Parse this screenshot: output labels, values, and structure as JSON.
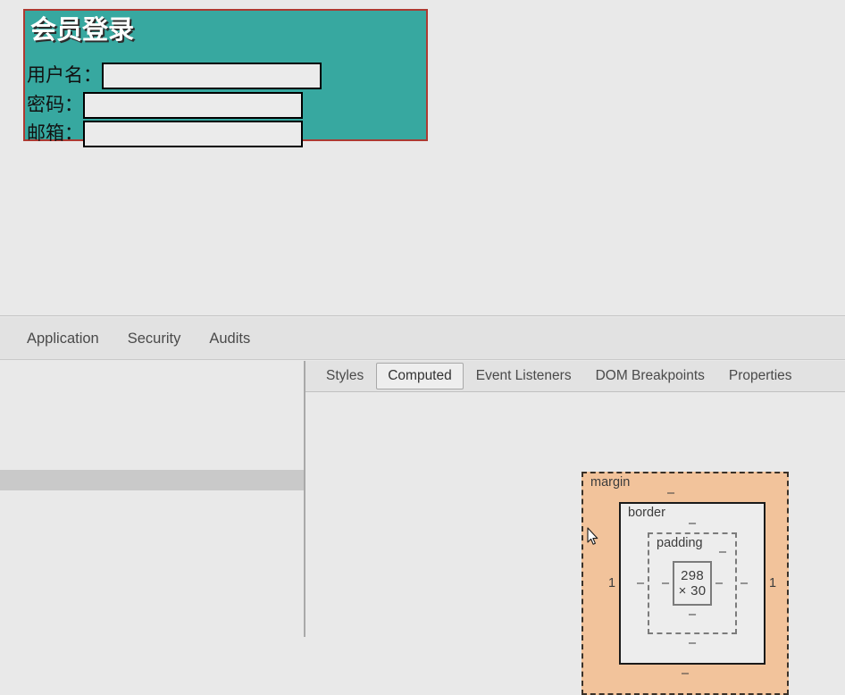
{
  "page": {
    "form": {
      "title": "会员登录",
      "fields": [
        {
          "label": "用户名：",
          "value": "",
          "placeholder": ""
        },
        {
          "label": "密码：",
          "value": "",
          "placeholder": ""
        },
        {
          "label": "邮箱：",
          "value": "",
          "placeholder": ""
        }
      ],
      "background_color": "#37a8a0",
      "border_color": "#ad3a32",
      "title_color": "#ffffff"
    }
  },
  "devtools": {
    "toolbar_tabs": [
      {
        "label": "Application",
        "active": false
      },
      {
        "label": "Security",
        "active": false
      },
      {
        "label": "Audits",
        "active": false
      }
    ],
    "sidebar_tabs": [
      {
        "label": "Styles",
        "active": false
      },
      {
        "label": "Computed",
        "active": true
      },
      {
        "label": "Event Listeners",
        "active": false
      },
      {
        "label": "DOM Breakpoints",
        "active": false
      },
      {
        "label": "Properties",
        "active": false
      }
    ],
    "box_model": {
      "margin": {
        "label": "margin",
        "top": "–",
        "right": "1",
        "bottom": "–",
        "left": "1"
      },
      "border": {
        "label": "border",
        "top": "–",
        "right": "–",
        "bottom": "–",
        "left": "–"
      },
      "padding": {
        "label": "padding",
        "top": "–",
        "right": "–",
        "bottom": "–",
        "left": "–"
      },
      "content": "298 × 30",
      "margin_color": "#f2c39b",
      "content_color": "#ededed"
    }
  }
}
